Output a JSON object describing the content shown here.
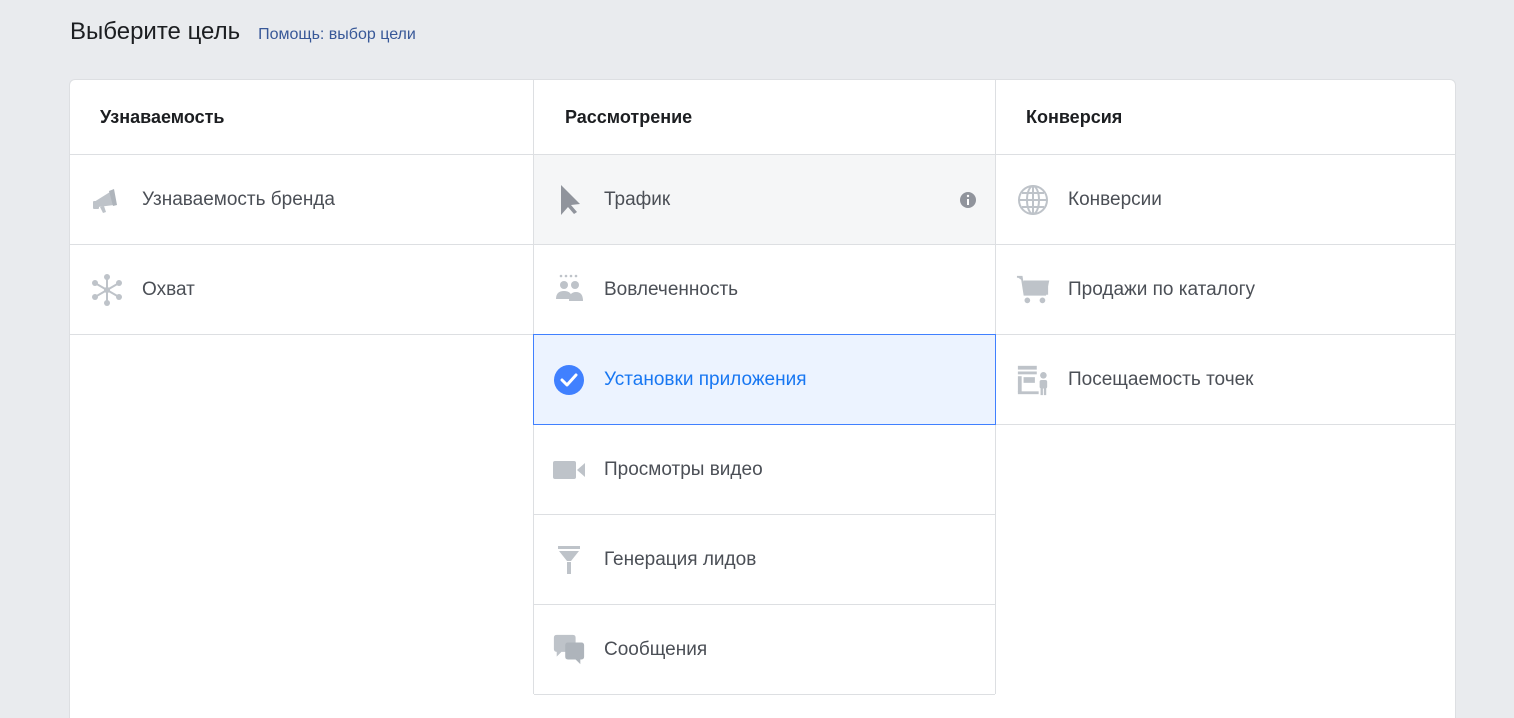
{
  "header": {
    "title": "Выберите цель",
    "help_link": "Помощь: выбор цели"
  },
  "columns": [
    {
      "title": "Узнаваемость",
      "items": [
        {
          "label": "Узнаваемость бренда",
          "icon": "megaphone-icon"
        },
        {
          "label": "Охват",
          "icon": "reach-icon"
        }
      ]
    },
    {
      "title": "Рассмотрение",
      "items": [
        {
          "label": "Трафик",
          "icon": "cursor-icon",
          "state": "hover"
        },
        {
          "label": "Вовлеченность",
          "icon": "people-icon"
        },
        {
          "label": "Установки приложения",
          "icon": "check-circle-icon",
          "state": "selected"
        },
        {
          "label": "Просмотры видео",
          "icon": "video-camera-icon"
        },
        {
          "label": "Генерация лидов",
          "icon": "funnel-icon"
        },
        {
          "label": "Сообщения",
          "icon": "chat-bubbles-icon"
        }
      ]
    },
    {
      "title": "Конверсия",
      "items": [
        {
          "label": "Конверсии",
          "icon": "globe-icon"
        },
        {
          "label": "Продажи по каталогу",
          "icon": "shopping-cart-icon"
        },
        {
          "label": "Посещаемость точек",
          "icon": "store-visit-icon"
        }
      ]
    }
  ],
  "colors": {
    "accent": "#1877f2",
    "selected_bg": "#ecf3ff",
    "icon_grey": "#bec3c9"
  }
}
